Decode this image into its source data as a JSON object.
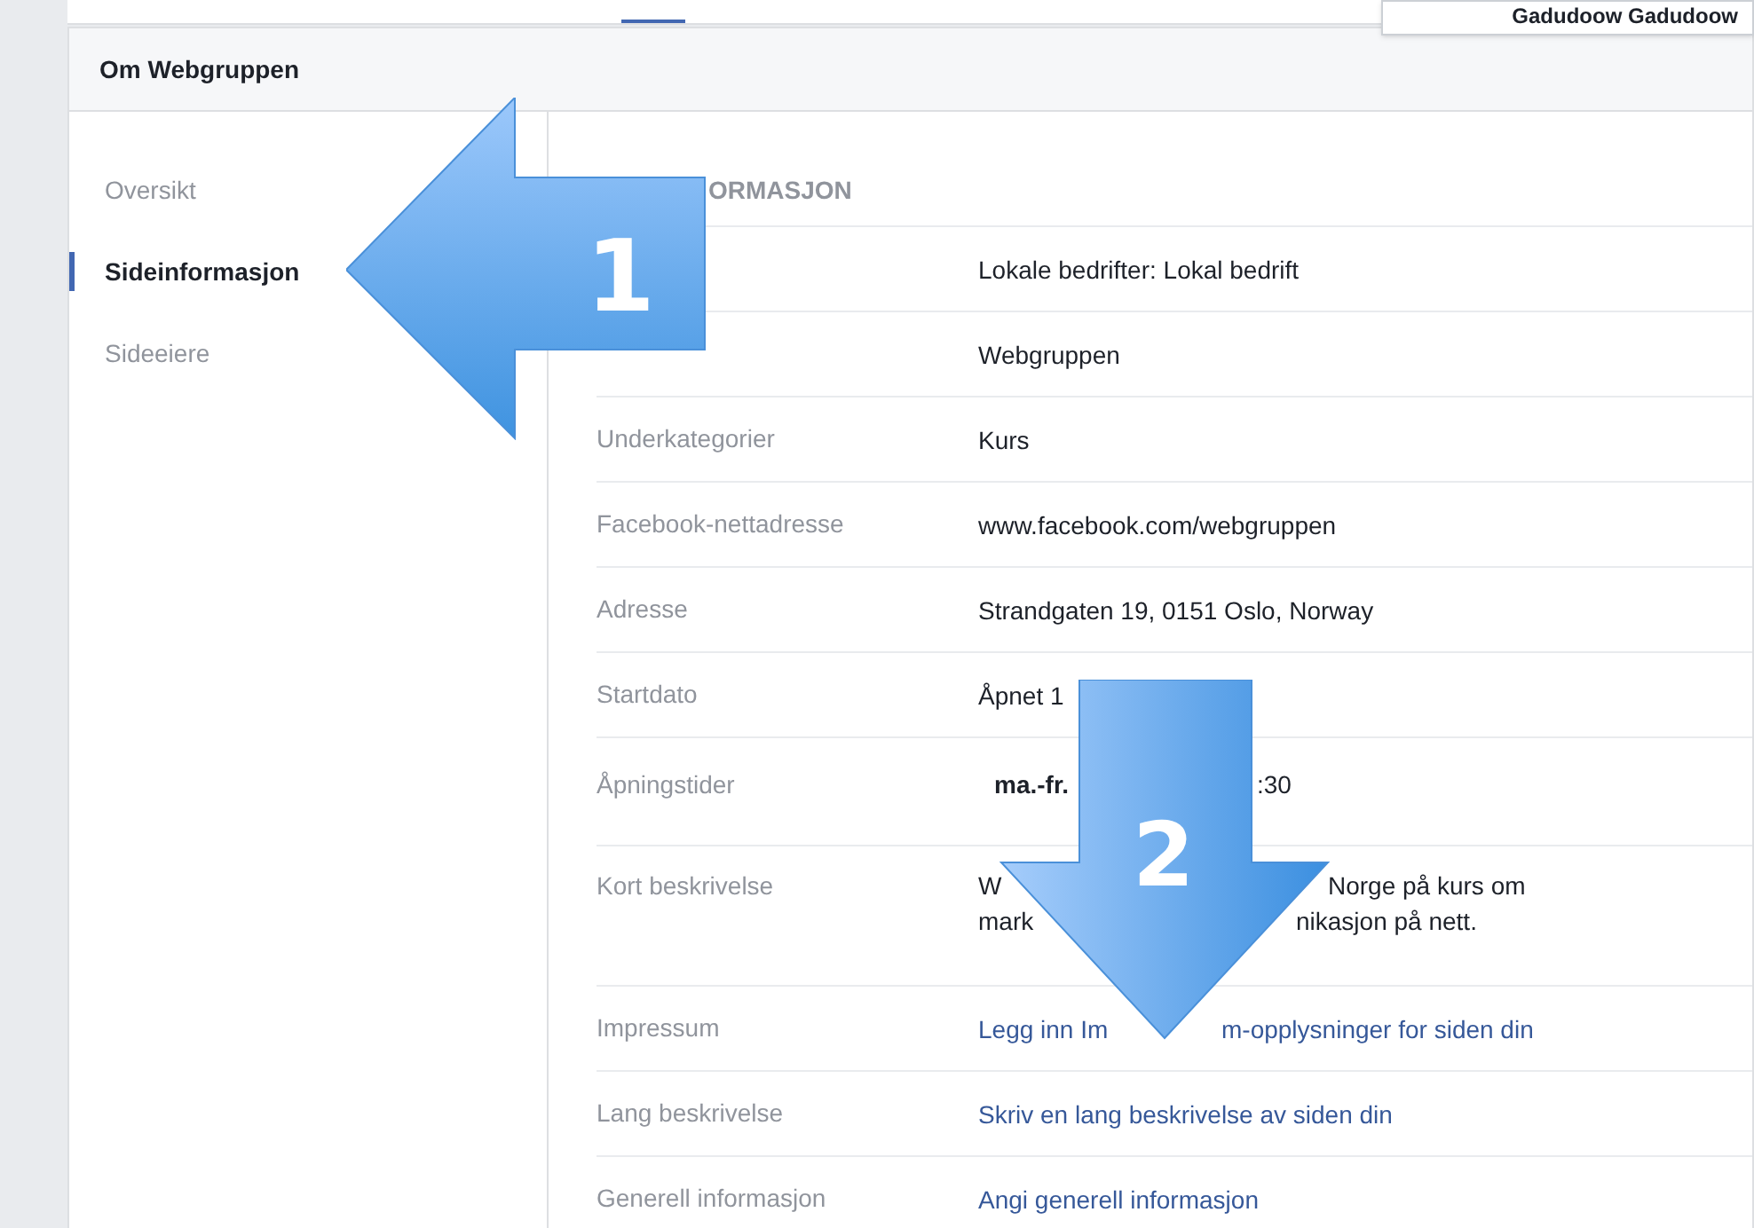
{
  "top_menu": {
    "name": "Gadudoow Gadudoow"
  },
  "card": {
    "title": "Om Webgruppen"
  },
  "sidebar": {
    "items": [
      {
        "label": "Oversikt",
        "selected": false
      },
      {
        "label": "Sideinformasjon",
        "selected": true
      },
      {
        "label": "Sideeiere",
        "selected": false
      }
    ]
  },
  "section": {
    "heading": "ORMASJON",
    "rows": [
      {
        "value": [
          "Lokale bedrifter: Lokal bedrift"
        ]
      },
      {
        "value": [
          "Webgruppen"
        ]
      },
      {
        "label": "Underkategorier",
        "value": [
          "Kurs"
        ]
      },
      {
        "label": "Facebook-nettadresse",
        "value": [
          "www.facebook.com/webgruppen"
        ]
      },
      {
        "label": "Adresse",
        "value": [
          "Strandgaten 19, 0151 Oslo, Norway"
        ]
      },
      {
        "label": "Startdato",
        "value": [
          "Åpnet 1"
        ]
      },
      {
        "label": "Åpningstider",
        "kind": "hours",
        "value": [
          "ma.-fr.",
          ":30"
        ]
      },
      {
        "label": "Kort beskrivelse",
        "kind": "split",
        "value": [
          "W",
          "Norge på kurs om"
        ],
        "value2": [
          "mark",
          "nikasjon på nett."
        ]
      },
      {
        "label": "Impressum",
        "kind": "link",
        "value": [
          "Legg inn Im",
          "m-opplysninger for siden din"
        ]
      },
      {
        "label": "Lang beskrivelse",
        "kind": "link",
        "value": [
          "Skriv en lang beskrivelse av siden din"
        ]
      },
      {
        "label": "Generell informasjon",
        "kind": "link",
        "value": [
          "Angi generell informasjon"
        ]
      }
    ]
  },
  "callouts": [
    {
      "number": "1"
    },
    {
      "number": "2"
    }
  ]
}
